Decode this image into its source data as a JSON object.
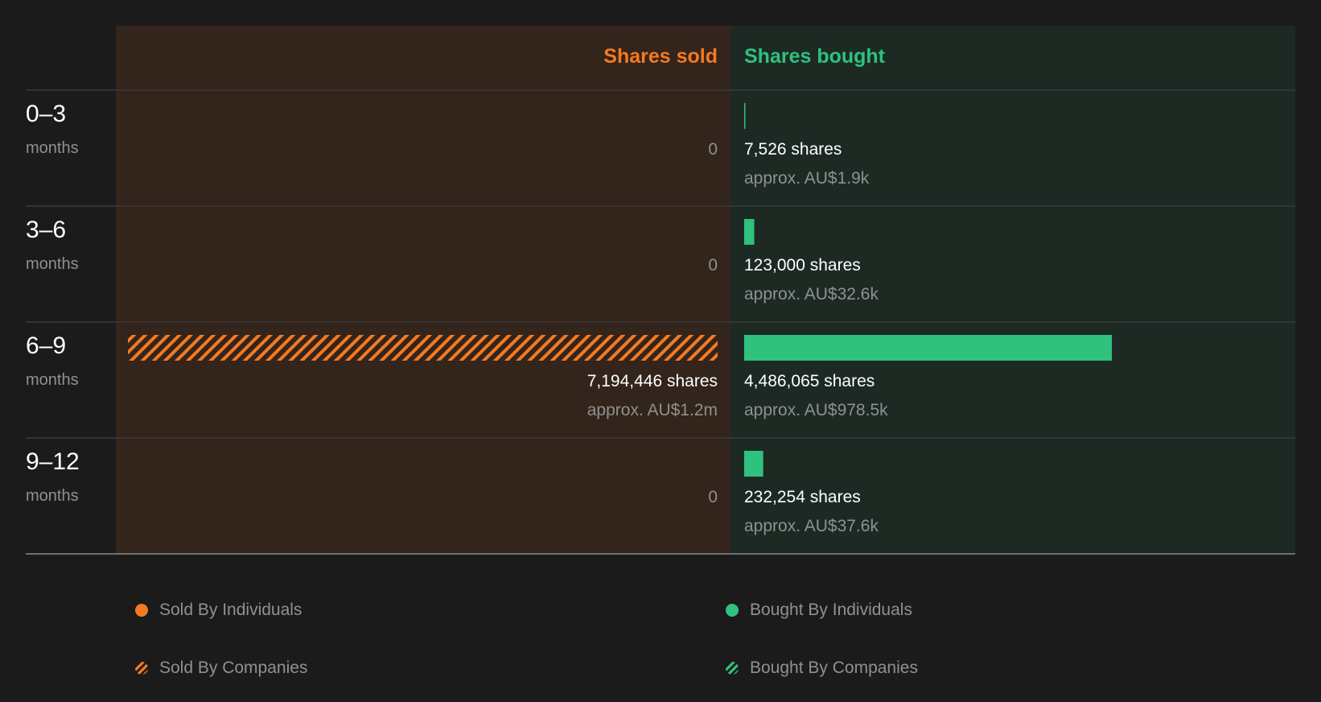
{
  "chart_data": {
    "type": "bar",
    "sold_header": "Shares sold",
    "bought_header": "Shares bought",
    "categories": [
      {
        "range": "0–3",
        "unit": "months"
      },
      {
        "range": "3–6",
        "unit": "months"
      },
      {
        "range": "6–9",
        "unit": "months"
      },
      {
        "range": "9–12",
        "unit": "months"
      }
    ],
    "series": [
      {
        "name": "Shares sold",
        "values": [
          0,
          0,
          7194446,
          0
        ],
        "value_labels": [
          "0",
          "0",
          "7,194,446 shares",
          "0"
        ],
        "approx_labels": [
          "",
          "",
          "approx. AU$1.2m",
          ""
        ],
        "breakdown": [
          "none",
          "none",
          "companies",
          "none"
        ]
      },
      {
        "name": "Shares bought",
        "values": [
          7526,
          123000,
          4486065,
          232254
        ],
        "value_labels": [
          "7,526 shares",
          "123,000 shares",
          "4,486,065 shares",
          "232,254 shares"
        ],
        "approx_labels": [
          "approx. AU$1.9k",
          "approx. AU$32.6k",
          "approx. AU$978.5k",
          "approx. AU$37.6k"
        ],
        "breakdown": [
          "individuals",
          "individuals",
          "individuals",
          "individuals"
        ]
      }
    ],
    "legend": [
      {
        "label": "Sold By Individuals",
        "style": "solid",
        "color": "#f47a20"
      },
      {
        "label": "Sold By Companies",
        "style": "hatched",
        "color": "#f47a20"
      },
      {
        "label": "Bought By Individuals",
        "style": "solid",
        "color": "#2ec27e"
      },
      {
        "label": "Bought By Companies",
        "style": "hatched",
        "color": "#2ec27e"
      }
    ],
    "colors": {
      "sold": "#f47a20",
      "bought": "#2ec27e",
      "sold_panel": "#33241c",
      "bought_panel": "#1d2a24",
      "background": "#1b1b1b"
    }
  }
}
